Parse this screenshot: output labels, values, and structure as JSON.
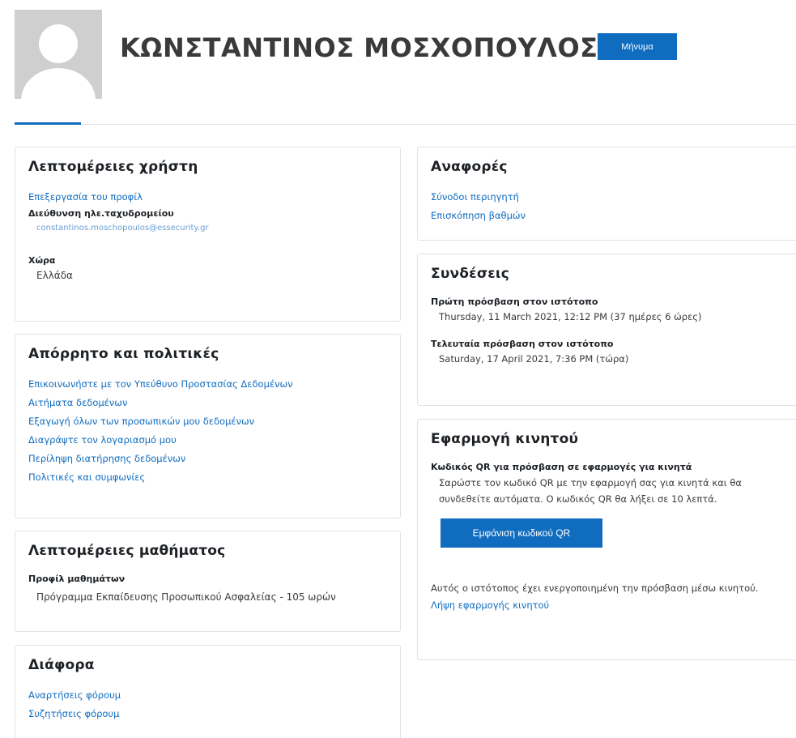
{
  "header": {
    "username": "ΚΩΝΣΤΑΝΤΙΝΟΣ ΜΟΣΧΟΠΟΥΛΟΣ",
    "message_button": "Μήνυμα",
    "avatar_icon": "default-user-avatar"
  },
  "user_details": {
    "title": "Λεπτομέρειες χρήστη",
    "edit_profile": "Επεξεργασία του προφίλ",
    "email_label": "Διεύθυνση ηλε.ταχυδρομείου",
    "email_value": "constantinos.moschopoulos@essecurity.gr",
    "country_label": "Χώρα",
    "country_value": "Ελλάδα"
  },
  "privacy": {
    "title": "Απόρρητο και πολιτικές",
    "links": [
      "Επικοινωνήστε με τον Υπεύθυνο Προστασίας Δεδομένων",
      "Αιτήματα δεδομένων",
      "Εξαγωγή όλων των προσωπικών μου δεδομένων",
      "Διαγράψτε τον λογαριασμό μου",
      "Περίληψη διατήρησης δεδομένων",
      "Πολιτικές και συμφωνίες"
    ]
  },
  "course_details": {
    "title": "Λεπτομέρειες μαθήματος",
    "profiles_label": "Προφίλ μαθημάτων",
    "profiles_value": "Πρόγραμμα Εκπαίδευσης Προσωπικού Ασφαλείας - 105 ωρών"
  },
  "misc": {
    "title": "Διάφορα",
    "links": [
      "Αναρτήσεις φόρουμ",
      "Συζητήσεις φόρουμ"
    ]
  },
  "reports": {
    "title": "Αναφορές",
    "links": [
      "Σύνοδοι περιηγητή",
      "Επισκόπηση βαθμών"
    ]
  },
  "logins": {
    "title": "Συνδέσεις",
    "first_label": "Πρώτη πρόσβαση στον ιστότοπο",
    "first_value": "Thursday, 11 March 2021, 12:12 PM  (37 ημέρες 6 ώρες)",
    "last_label": "Τελευταία πρόσβαση στον ιστότοπο",
    "last_value": "Saturday, 17 April 2021, 7:36 PM  (τώρα)"
  },
  "mobile_app": {
    "title": "Εφαρμογή κινητού",
    "qr_label": "Κωδικός QR για πρόσβαση σε εφαρμογές για κινητά",
    "qr_desc": "Σαρώστε τον κωδικό QR με την εφαρμογή σας για κινητά και θα συνδεθείτε αυτόματα. Ο κωδικός QR θα λήξει σε 10 λεπτά.",
    "qr_button": "Εμφάνιση κωδικού QR",
    "mobile_enabled": "Αυτός ο ιστότοπος έχει ενεργοποιημένη την πρόσβαση μέσω κινητού.",
    "get_app": "Λήψη εφαρμογής κινητού"
  },
  "colors": {
    "accent": "#0f6cbf",
    "border": "#dee2e6",
    "avatar_bg": "#cfcfcf"
  }
}
